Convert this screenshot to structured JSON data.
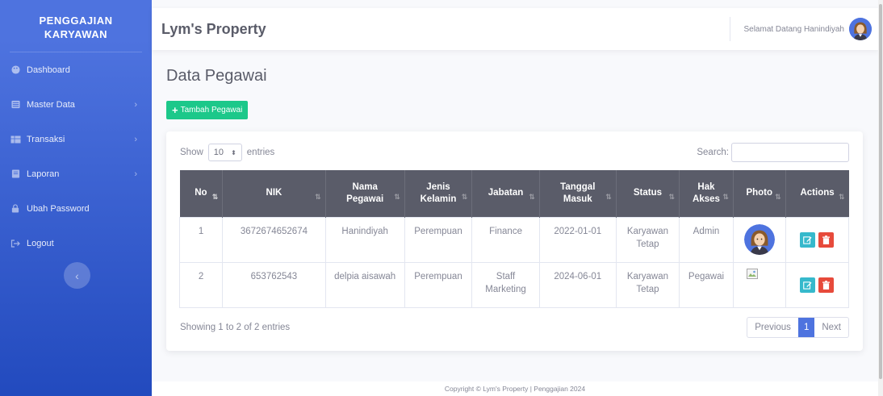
{
  "sidebar": {
    "brand_line1": "PENGGAJIAN",
    "brand_line2": "KARYAWAN",
    "items": [
      {
        "label": "Dashboard",
        "icon": "palette-icon"
      },
      {
        "label": "Master Data",
        "icon": "database-icon"
      },
      {
        "label": "Transaksi",
        "icon": "table-icon"
      },
      {
        "label": "Laporan",
        "icon": "folder-icon"
      },
      {
        "label": "Ubah Password",
        "icon": "lock-icon"
      },
      {
        "label": "Logout",
        "icon": "logout-icon"
      }
    ],
    "toggle_glyph": "‹"
  },
  "topbar": {
    "app_title": "Lym's Property",
    "welcome": "Selamat Datang Hanindiyah"
  },
  "main": {
    "page_title": "Data Pegawai",
    "add_button": "Tambah Pegawai",
    "show_label": "Show",
    "entries_value": "10",
    "entries_label": "entries",
    "search_label": "Search:",
    "columns": [
      "No",
      "NIK",
      "Nama Pegawai",
      "Jenis Kelamin",
      "Jabatan",
      "Tanggal Masuk",
      "Status",
      "Hak Akses",
      "Photo",
      "Actions"
    ],
    "rows": [
      {
        "no": "1",
        "nik": "3672674652674",
        "nama": "Hanindiyah",
        "jk": "Perempuan",
        "jabatan": "Finance",
        "tanggal": "2022-01-01",
        "status": "Karyawan Tetap",
        "akses": "Admin"
      },
      {
        "no": "2",
        "nik": "653762543",
        "nama": "delpia aisawah",
        "jk": "Perempuan",
        "jabatan": "Staff Marketing",
        "tanggal": "2024-06-01",
        "status": "Karyawan Tetap",
        "akses": "Pegawai"
      }
    ],
    "info": "Showing 1 to 2 of 2 entries",
    "pager": {
      "prev": "Previous",
      "page": "1",
      "next": "Next"
    }
  },
  "footer": "Copyright © Lym's Property | Penggajian 2024",
  "colors": {
    "sidebar": "#4e73df",
    "success": "#1cc88a",
    "info": "#36b9cc",
    "danger": "#e74a3b",
    "header": "#5a5c69"
  }
}
